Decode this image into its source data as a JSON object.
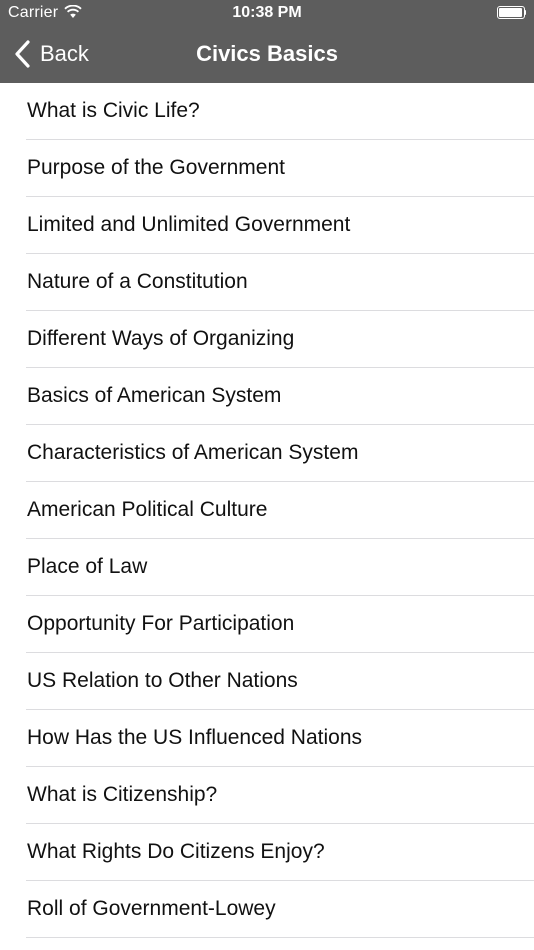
{
  "status_bar": {
    "carrier": "Carrier",
    "time": "10:38 PM"
  },
  "nav": {
    "back_label": "Back",
    "title": "Civics Basics"
  },
  "colors": {
    "nav_background": "#5d5d5d",
    "nav_text": "#ffffff",
    "separator": "#dcdcdf"
  },
  "list": {
    "items": [
      {
        "label": "What is Civic Life?"
      },
      {
        "label": "Purpose of the Government"
      },
      {
        "label": "Limited and Unlimited Government"
      },
      {
        "label": "Nature of a Constitution"
      },
      {
        "label": "Different Ways of Organizing"
      },
      {
        "label": "Basics of American System"
      },
      {
        "label": "Characteristics of American System"
      },
      {
        "label": "American Political Culture"
      },
      {
        "label": "Place of Law"
      },
      {
        "label": "Opportunity For Participation"
      },
      {
        "label": "US Relation to Other Nations"
      },
      {
        "label": "How Has the US Influenced Nations"
      },
      {
        "label": "What is Citizenship?"
      },
      {
        "label": "What Rights Do Citizens Enjoy?"
      },
      {
        "label": "Roll of Government-Lowey"
      }
    ]
  }
}
